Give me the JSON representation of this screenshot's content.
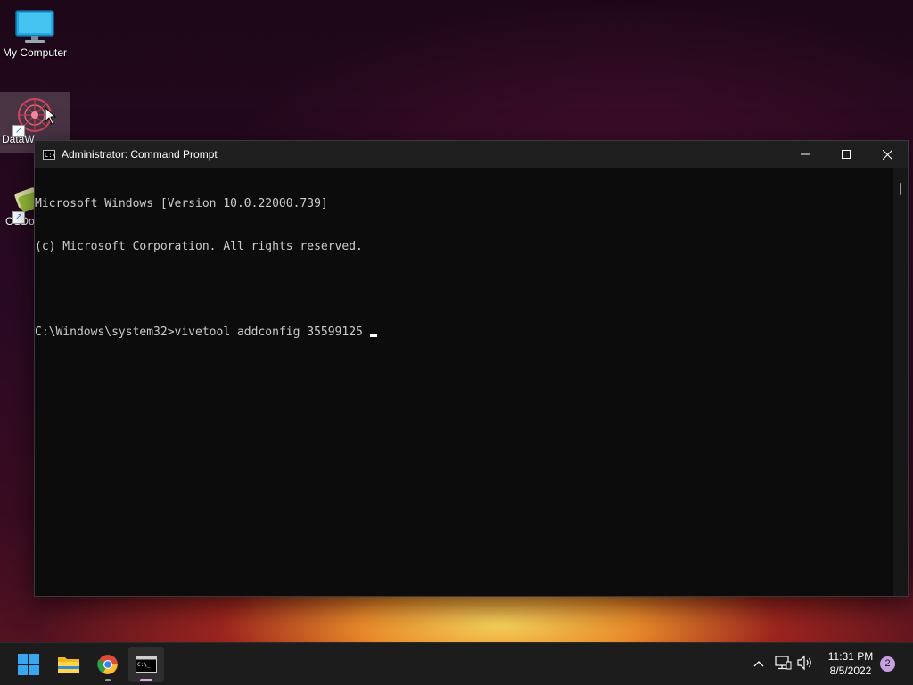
{
  "desktop": {
    "icons": [
      {
        "label": "My Computer"
      },
      {
        "label": "DataW"
      },
      {
        "label": "OSDov"
      }
    ]
  },
  "window": {
    "title": "Administrator: Command Prompt",
    "icon_text": "C:\\",
    "console_lines": [
      "Microsoft Windows [Version 10.0.22000.739]",
      "(c) Microsoft Corporation. All rights reserved.",
      "",
      "C:\\Windows\\system32>vivetool addconfig 35599125"
    ]
  },
  "taskbar": {
    "apps": [
      "start-icon",
      "file-explorer-icon",
      "chrome-icon",
      "command-prompt-icon"
    ],
    "clock_time": "11:31 PM",
    "clock_date": "8/5/2022",
    "notification_count": "2",
    "accent_color": "#d9a8e8"
  }
}
